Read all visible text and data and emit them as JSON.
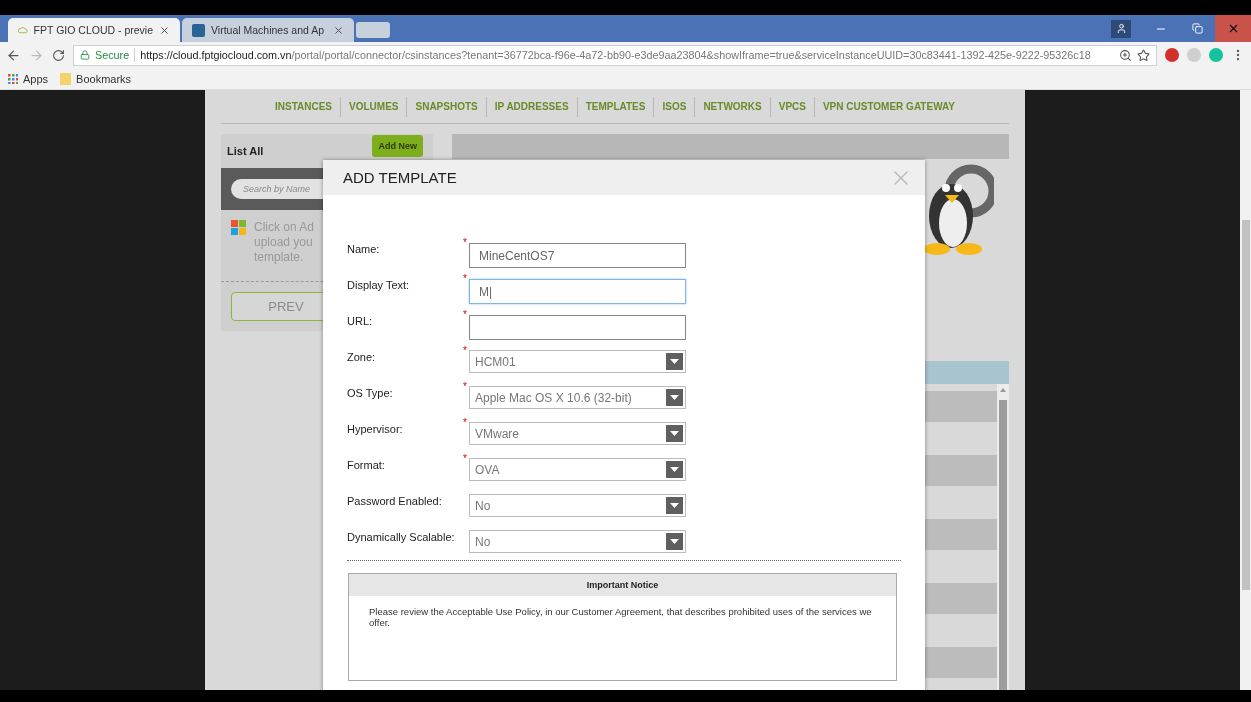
{
  "browser": {
    "tabs": [
      {
        "title": "FPT GIO CLOUD - previe",
        "selected": true
      },
      {
        "title": "Virtual Machines and Ap",
        "selected": false
      }
    ],
    "secure_label": "Secure",
    "url_host": "https://cloud.fptgiocloud.com.vn",
    "url_path": "/portal/portal/connector/csinstances?tenant=36772bca-f96e-4a72-bb90-e3de9aa23804&showIframe=true&serviceInstanceUUID=30c83441-1392-425e-9222-95326c18",
    "bookmarks": [
      "Apps",
      "Bookmarks"
    ]
  },
  "nav": [
    "INSTANCES",
    "VOLUMES",
    "SNAPSHOTS",
    "IP ADDRESSES",
    "TEMPLATES",
    "ISOS",
    "NETWORKS",
    "VPCS",
    "VPN CUSTOMER GATEWAY"
  ],
  "left_panel": {
    "title": "List All",
    "add_button": "Add New",
    "search_placeholder": "Search by Name",
    "hint_lines": [
      "Click on Ad",
      "upload you",
      "template."
    ],
    "prev_button": "PREV"
  },
  "modal": {
    "title": "ADD TEMPLATE",
    "fields": [
      {
        "label": "Name:",
        "kind": "text",
        "required_mark": "*",
        "value": "MineCentOS7",
        "focused": false
      },
      {
        "label": "Display Text:",
        "kind": "text",
        "required_mark": "*",
        "value": "M|",
        "focused": true
      },
      {
        "label": "URL:",
        "kind": "text",
        "required_mark": "*",
        "focused": false
      },
      {
        "label": "Zone:",
        "kind": "select",
        "required_mark": "*",
        "value": "HCM01"
      },
      {
        "label": "OS Type:",
        "kind": "select",
        "required_mark": "*",
        "value": "Apple Mac OS X 10.6 (32-bit)"
      },
      {
        "label": "Hypervisor:",
        "kind": "select",
        "required_mark": "*",
        "value": "VMware"
      },
      {
        "label": "Format:",
        "kind": "select",
        "required_mark": "*",
        "value": "OVA"
      },
      {
        "label": "Password Enabled:",
        "kind": "select",
        "value": "No"
      },
      {
        "label": "Dynamically Scalable:",
        "kind": "select",
        "value": "No"
      }
    ],
    "notice": {
      "title": "Important Notice",
      "text": "Please review the Acceptable Use Policy, in our Customer Agreement, that describes prohibited uses of the services we offer."
    }
  }
}
